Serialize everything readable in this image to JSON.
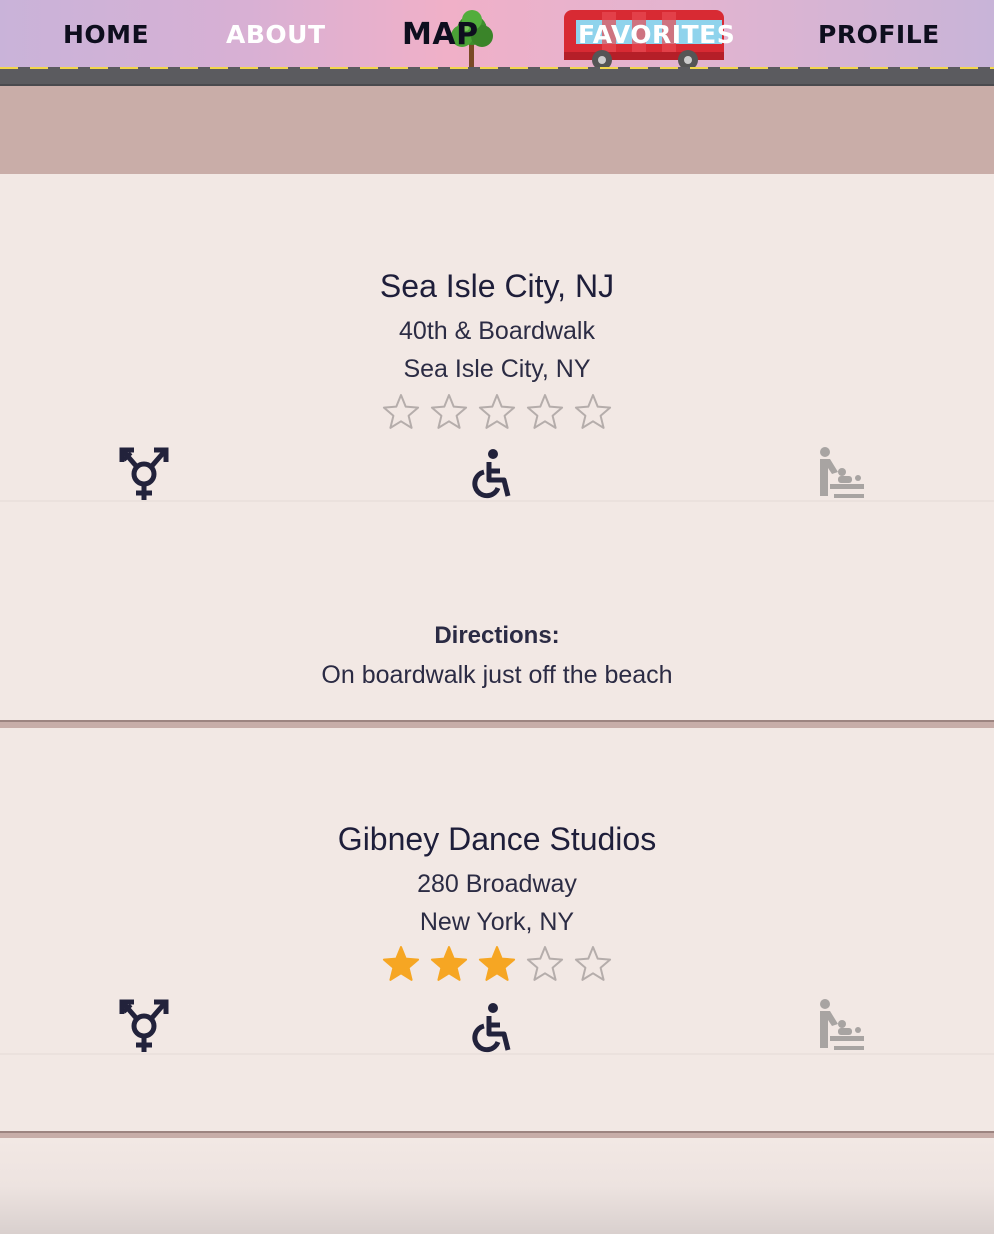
{
  "nav": {
    "home": "HOME",
    "about": "ABOUT",
    "map": "MAP",
    "favorites": "FAVORITES",
    "profile": "PROFILE"
  },
  "colors": {
    "star_filled": "#f6a623",
    "star_empty": "#b5adab",
    "icon_active": "#22223b",
    "icon_inactive": "#a8a4a2"
  },
  "favorites": [
    {
      "name": "Sea Isle City, NJ",
      "address": "40th & Boardwalk",
      "city": "Sea Isle City, NY",
      "rating": 0,
      "rating_max": 5,
      "amenities": [
        {
          "icon": "transgender-icon",
          "available": true
        },
        {
          "icon": "wheelchair-accessible-icon",
          "available": true
        },
        {
          "icon": "baby-changing-icon",
          "available": false
        }
      ],
      "directions_label": "Directions:",
      "directions": "On boardwalk just off the beach"
    },
    {
      "name": "Gibney Dance Studios",
      "address": "280 Broadway",
      "city": "New York, NY",
      "rating": 3,
      "rating_max": 5,
      "amenities": [
        {
          "icon": "transgender-icon",
          "available": true
        },
        {
          "icon": "wheelchair-accessible-icon",
          "available": true
        },
        {
          "icon": "baby-changing-icon",
          "available": false
        }
      ]
    }
  ]
}
